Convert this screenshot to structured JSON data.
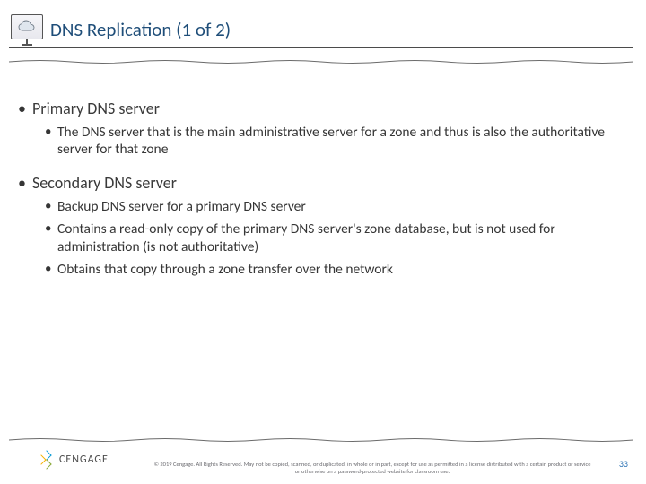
{
  "header": {
    "title": "DNS Replication (1 of 2)",
    "icon": "cloud-icon"
  },
  "bullets": {
    "primary": {
      "label": "Primary DNS server",
      "sub": [
        "The DNS server that is the main administrative server for a zone and thus is also the authoritative server for that zone"
      ]
    },
    "secondary": {
      "label": "Secondary DNS server",
      "sub": [
        "Backup DNS server for a primary DNS server",
        "Contains a read-only copy of the primary DNS server's zone database, but is not used for administration (is not authoritative)",
        "Obtains that copy through a zone transfer over the network"
      ]
    }
  },
  "footer": {
    "logo_text": "CENGAGE",
    "copyright": "© 2019 Cengage. All Rights Reserved. May not be copied, scanned, or duplicated, in whole or in part, except for use as permitted in a license distributed with a certain product or service or otherwise on a password-protected website for classroom use.",
    "page_number": "33"
  }
}
